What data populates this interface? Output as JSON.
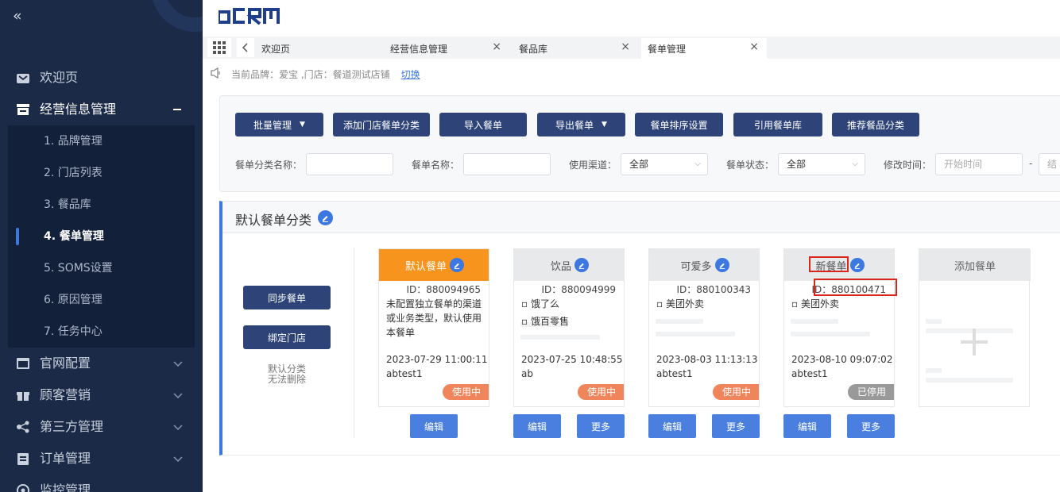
{
  "sidebar": {
    "collapse_icon": "double-chevron-left",
    "items": [
      {
        "label": "欢迎页",
        "icon": "home-icon"
      },
      {
        "label": "经营信息管理",
        "icon": "store-icon"
      },
      {
        "label": "官网配置",
        "icon": "window-icon"
      },
      {
        "label": "顾客营销",
        "icon": "gift-icon"
      },
      {
        "label": "第三方管理",
        "icon": "share-icon"
      },
      {
        "label": "订单管理",
        "icon": "clipboard-icon"
      },
      {
        "label": "监控管理",
        "icon": "monitor-icon"
      }
    ],
    "sub_items": [
      {
        "label": "1. 品牌管理"
      },
      {
        "label": "2. 门店列表"
      },
      {
        "label": "3. 餐品库"
      },
      {
        "label": "4. 餐单管理"
      },
      {
        "label": "5. SOMS设置"
      },
      {
        "label": "6. 原因管理"
      },
      {
        "label": "7. 任务中心"
      }
    ],
    "active_sub": "4. 餐单管理",
    "colors": {
      "bg": "#1b2a47",
      "active_indicator": "#3c78e0"
    }
  },
  "header": {
    "logo_text": "oCRM"
  },
  "tabs": [
    {
      "label": "欢迎页",
      "closable": false
    },
    {
      "label": "经营信息管理",
      "closable": true
    },
    {
      "label": "餐品库",
      "closable": true
    },
    {
      "label": "餐单管理",
      "closable": true,
      "active": true
    }
  ],
  "notice": {
    "text": "当前品牌：爱宝 ,门店：餐道测试店铺",
    "switch_label": "切换"
  },
  "toolbar": {
    "buttons": [
      {
        "label": "批量管理",
        "dropdown": true
      },
      {
        "label": "添加门店餐单分类"
      },
      {
        "label": "导入餐单"
      },
      {
        "label": "导出餐单",
        "dropdown": true
      },
      {
        "label": "餐单排序设置"
      },
      {
        "label": "引用餐单库"
      },
      {
        "label": "推荐餐品分类"
      }
    ]
  },
  "filters": {
    "category_name_label": "餐单分类名称：",
    "category_name_value": "",
    "menu_name_label": "餐单名称：",
    "menu_name_value": "",
    "channel_label": "使用渠道：",
    "channel_value": "全部",
    "status_label": "餐单状态：",
    "status_value": "全部",
    "modified_label": "修改时间：",
    "start_placeholder": "开始时间",
    "range_sep": "-",
    "end_placeholder": "结"
  },
  "category": {
    "title": "默认餐单分类",
    "sync_label": "同步餐单",
    "bind_label": "绑定门店",
    "note_line1": "默认分类",
    "note_line2": "无法删除"
  },
  "cards": [
    {
      "name": "默认餐单",
      "id": "ID：880094965",
      "desc": "未配置独立餐单的渠道或业务类型，默认使用本餐单",
      "time": "2023-07-29 11:00:11",
      "user": "abtest1",
      "status": "使用中",
      "default": true,
      "actions": [
        "编辑"
      ]
    },
    {
      "name": "饮品",
      "id": "ID：880094999",
      "channels": [
        "饿了么",
        "饿百零售"
      ],
      "time": "2023-07-25 10:48:55",
      "user": "ab",
      "status": "使用中",
      "actions": [
        "编辑",
        "更多"
      ]
    },
    {
      "name": "可爱多",
      "id": "ID：880100343",
      "channels": [
        "美团外卖"
      ],
      "time": "2023-08-03 11:13:13",
      "user": "abtest1",
      "status": "使用中",
      "actions": [
        "编辑",
        "更多"
      ]
    },
    {
      "name": "新餐单",
      "id": "ID：880100471",
      "channels": [
        "美团外卖"
      ],
      "time": "2023-08-10 09:07:02",
      "user": "abtest1",
      "status": "已停用",
      "highlighted": true,
      "actions": [
        "编辑",
        "更多"
      ]
    }
  ],
  "add_card": {
    "label": "添加餐单",
    "icon": "plus-icon"
  },
  "colors": {
    "primary_btn": "#2e4479",
    "edit_btn": "#4a7fe0",
    "default_card": "#f7941d",
    "in_use": "#f0845a",
    "stopped": "#999999",
    "highlight": "#d9261c"
  }
}
